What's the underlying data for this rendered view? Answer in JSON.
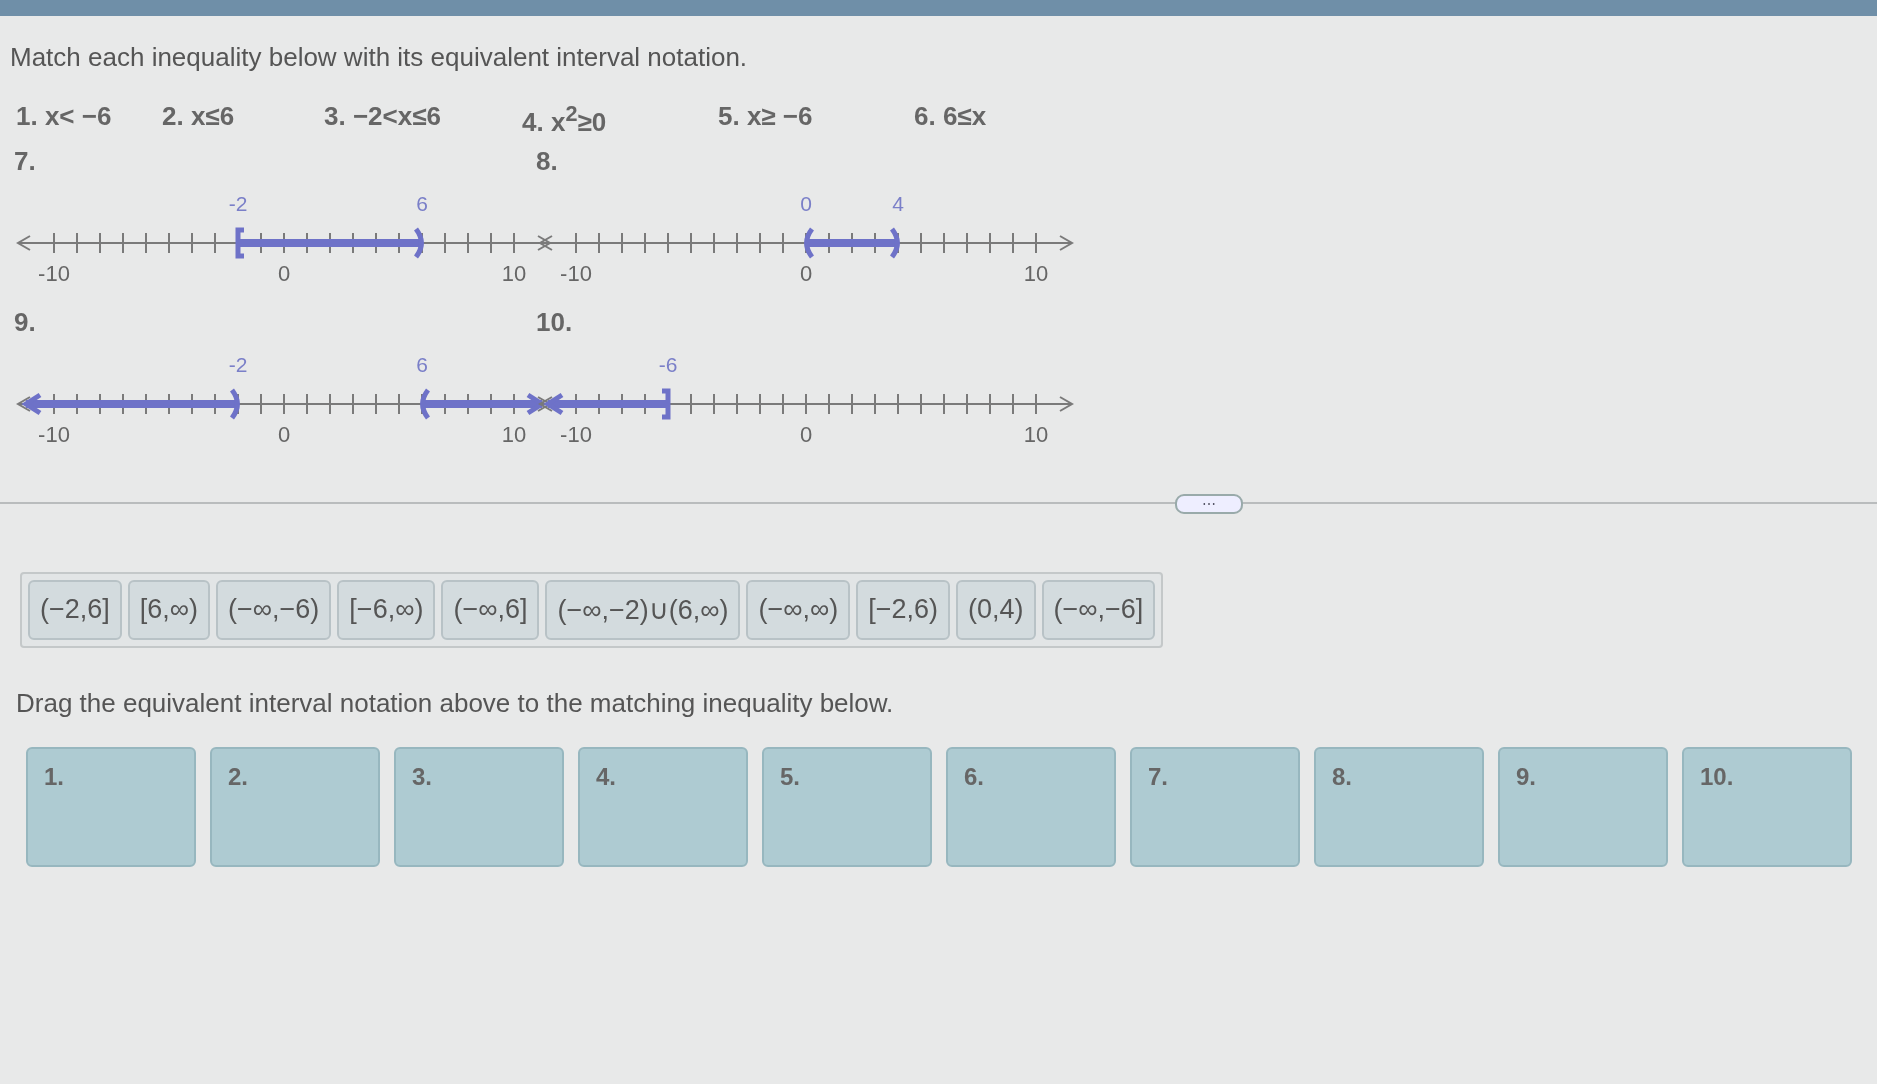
{
  "instruction": "Match each inequality below with its equivalent interval notation.",
  "inequalities": [
    "1. x< −6",
    "2. x≤6",
    "3. −2<x≤6",
    "4. x$^{2}$≥0",
    "5. x≥ −6",
    "6. 6≤x"
  ],
  "number_lines": [
    {
      "number": "7.",
      "ticks": [
        "-10",
        "0",
        "10"
      ],
      "segments": [
        {
          "ends": [
            {
              "kind": "bracket",
              "label": "-2"
            },
            {
              "kind": "paren",
              "label": "6"
            }
          ]
        }
      ]
    },
    {
      "number": "8.",
      "ticks": [
        "-10",
        "0",
        "10"
      ],
      "segments": [
        {
          "ends": [
            {
              "kind": "paren",
              "label": "0"
            },
            {
              "kind": "paren",
              "label": "4"
            }
          ]
        }
      ]
    },
    {
      "number": "9.",
      "ticks": [
        "-10",
        "0",
        "10"
      ],
      "segments": [
        {
          "ends": [
            {
              "kind": "arrow"
            },
            {
              "kind": "paren",
              "label": "-2"
            }
          ]
        },
        {
          "ends": [
            {
              "kind": "paren",
              "label": "6"
            },
            {
              "kind": "arrow"
            }
          ]
        }
      ]
    },
    {
      "number": "10.",
      "ticks": [
        "-10",
        "0",
        "10"
      ],
      "segments": [
        {
          "ends": [
            {
              "kind": "arrow"
            },
            {
              "kind": "bracket",
              "label": "-6"
            }
          ]
        }
      ]
    }
  ],
  "divider_handle": "⋯",
  "answers": [
    "(−2,6]",
    "[6,∞)",
    "(−∞,−6)",
    "[−6,∞)",
    "(−∞,6]",
    "(−∞,−2)∪(6,∞)",
    "(−∞,∞)",
    "[−2,6)",
    "(0,4)",
    "(−∞,−6]"
  ],
  "drag_instruction": "Drag the equivalent interval notation above to the matching inequality below.",
  "drop_zones": [
    "1.",
    "2.",
    "3.",
    "4.",
    "5.",
    "6.",
    "7.",
    "8.",
    "9.",
    "10."
  ]
}
